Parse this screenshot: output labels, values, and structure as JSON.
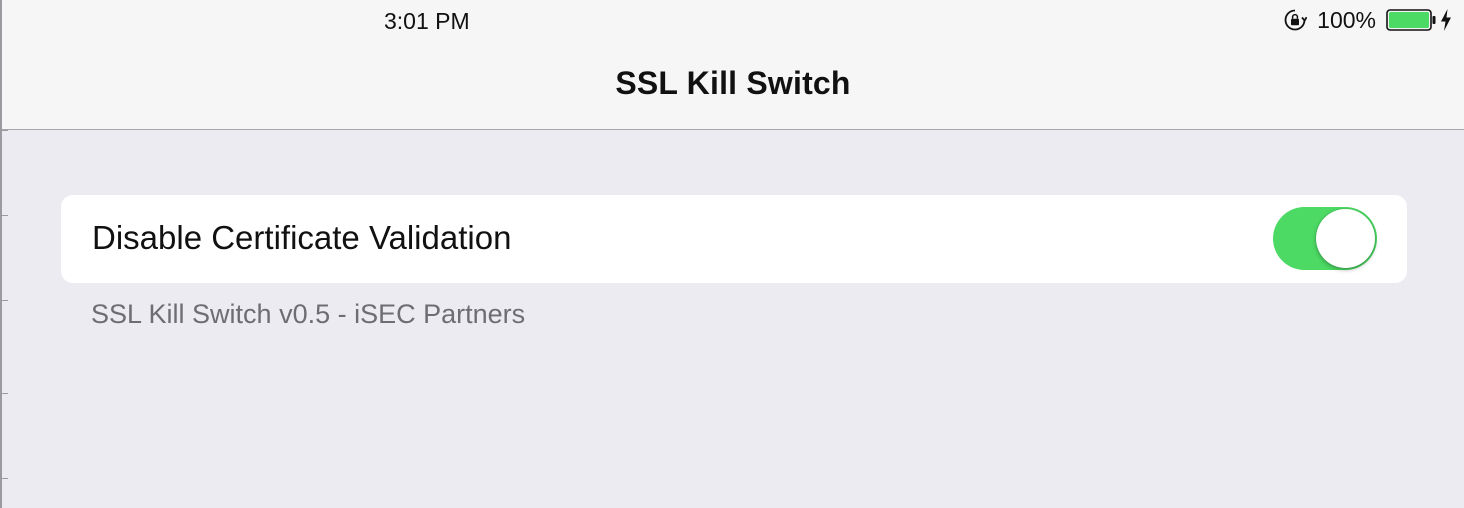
{
  "status_bar": {
    "time": "3:01 PM",
    "battery_percent": "100%",
    "battery_level": 1.0,
    "icons": [
      "rotation-lock-icon",
      "battery-icon",
      "charging-bolt-icon"
    ]
  },
  "nav": {
    "title": "SSL Kill Switch"
  },
  "settings": {
    "disable_cert_validation": {
      "label": "Disable Certificate Validation",
      "enabled": true
    },
    "footer": "SSL Kill Switch v0.5 - iSEC Partners"
  },
  "colors": {
    "toggle_on": "#4cd964",
    "battery_fill": "#4cd964",
    "background": "#ebebf1",
    "nav_background": "#f6f6f7"
  }
}
